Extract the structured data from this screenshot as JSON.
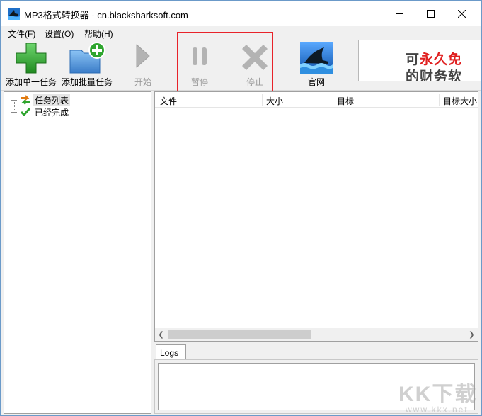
{
  "window": {
    "title": "MP3格式转换器 - cn.blacksharksoft.com"
  },
  "menu": [
    {
      "label": "文件(F)"
    },
    {
      "label": "设置(O)"
    },
    {
      "label": "帮助(H)"
    }
  ],
  "toolbar": {
    "add_one": "添加单一任务",
    "add_batch": "添加批量任务",
    "start": "开始",
    "pause": "暂停",
    "stop": "停止",
    "site": "官网"
  },
  "ad": {
    "line1_prefix": "可",
    "line1_red": "永久免",
    "line2": "的财务软"
  },
  "tree": [
    {
      "label": "任务列表"
    },
    {
      "label": "已经完成"
    }
  ],
  "list": {
    "columns": [
      "文件",
      "大小",
      "目标",
      "目标大小"
    ]
  },
  "logs": {
    "tab_label": "Logs"
  },
  "watermark": {
    "text": "KK下载",
    "sub": "www.kkx.net"
  },
  "colors": {
    "highlight": "#e8232a",
    "green": "#2fa52f",
    "folder": "#4a8fd8"
  }
}
